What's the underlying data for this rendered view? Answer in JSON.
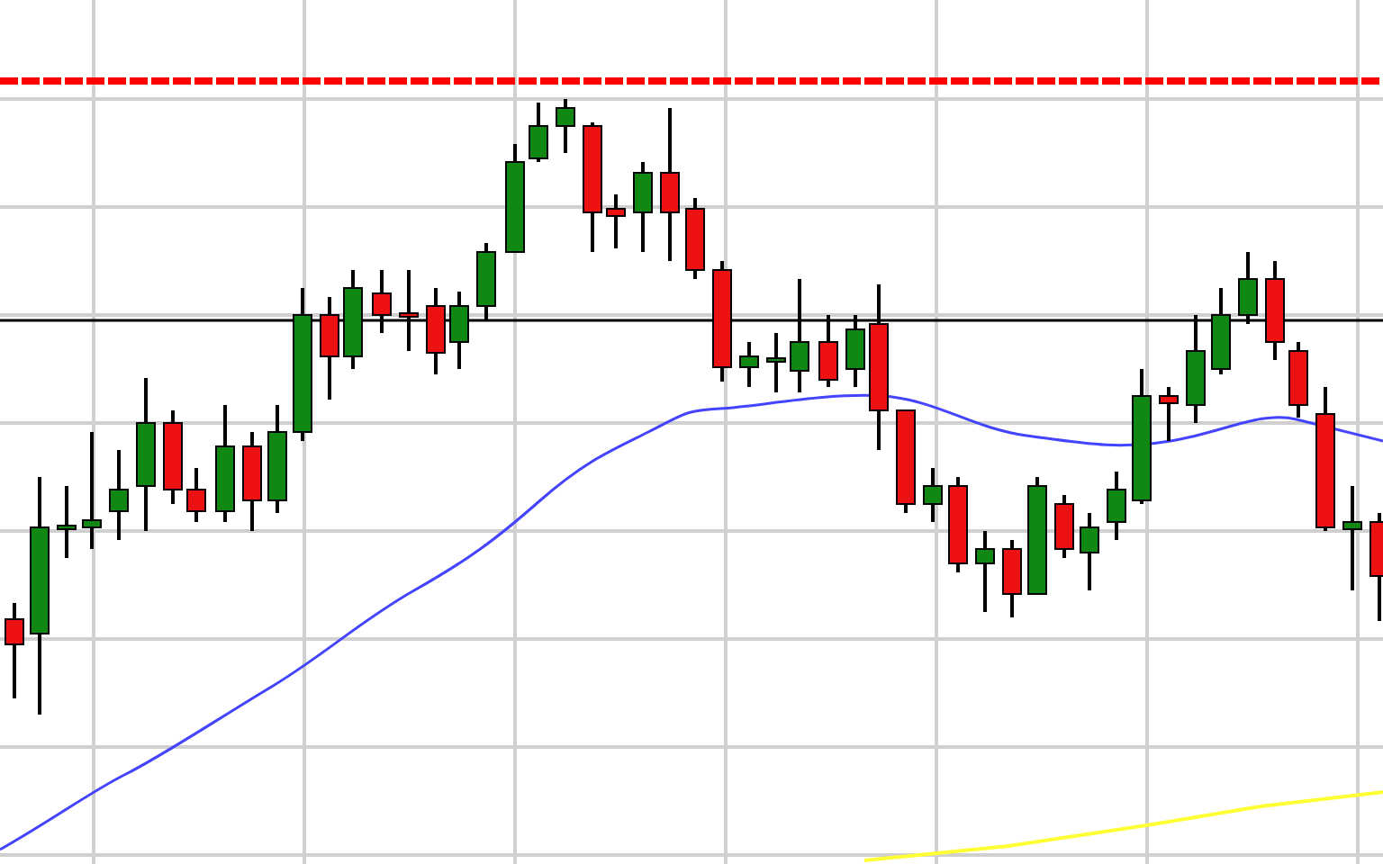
{
  "chart": {
    "kind": "candlestick"
  }
}
